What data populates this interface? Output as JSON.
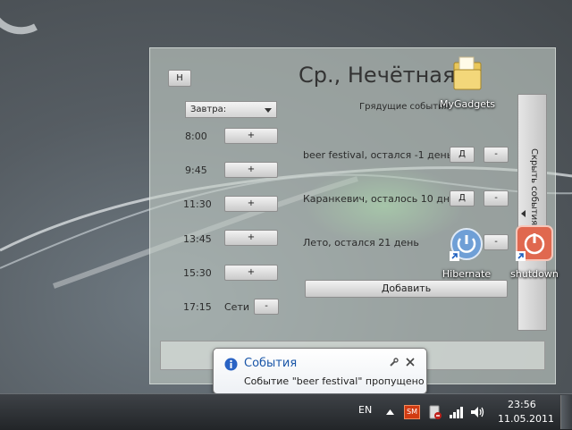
{
  "desktop": {
    "icons": [
      {
        "label": "MyGadgets"
      },
      {
        "label": "Hibernate"
      },
      {
        "label": "shutdown"
      }
    ]
  },
  "gadget": {
    "day_button": "Н",
    "date_title": "Ср., Нечётная",
    "day_select": "Завтра:",
    "schedule": [
      {
        "time": "8:00",
        "action": "+"
      },
      {
        "time": "9:45",
        "action": "+"
      },
      {
        "time": "11:30",
        "action": "+"
      },
      {
        "time": "13:45",
        "action": "+"
      },
      {
        "time": "15:30",
        "action": "+"
      }
    ],
    "last_slot": {
      "time": "17:15",
      "label": "Сети",
      "action": "-"
    },
    "events_header": "Грядущие события:",
    "events": [
      {
        "text": "beer festival, остался -1 день",
        "d_label": "Д",
        "minus_label": "-"
      },
      {
        "text": "Каранкевич, осталось 10 дней",
        "d_label": "Д",
        "minus_label": "-"
      },
      {
        "text": "Лето, остался 21 день",
        "d_label": "",
        "minus_label": "-"
      }
    ],
    "add_button": "Добавить",
    "hide_events_button": "Скрыть события"
  },
  "notification": {
    "title": "События",
    "message": "Событие \"beer festival\" пропущено"
  },
  "taskbar": {
    "language": "EN",
    "tray_app_label": "SM",
    "clock_time": "23:56",
    "clock_date": "11.05.2011"
  },
  "colors": {
    "notification_title": "#1a56a8",
    "tray_app": "#d13b12"
  }
}
